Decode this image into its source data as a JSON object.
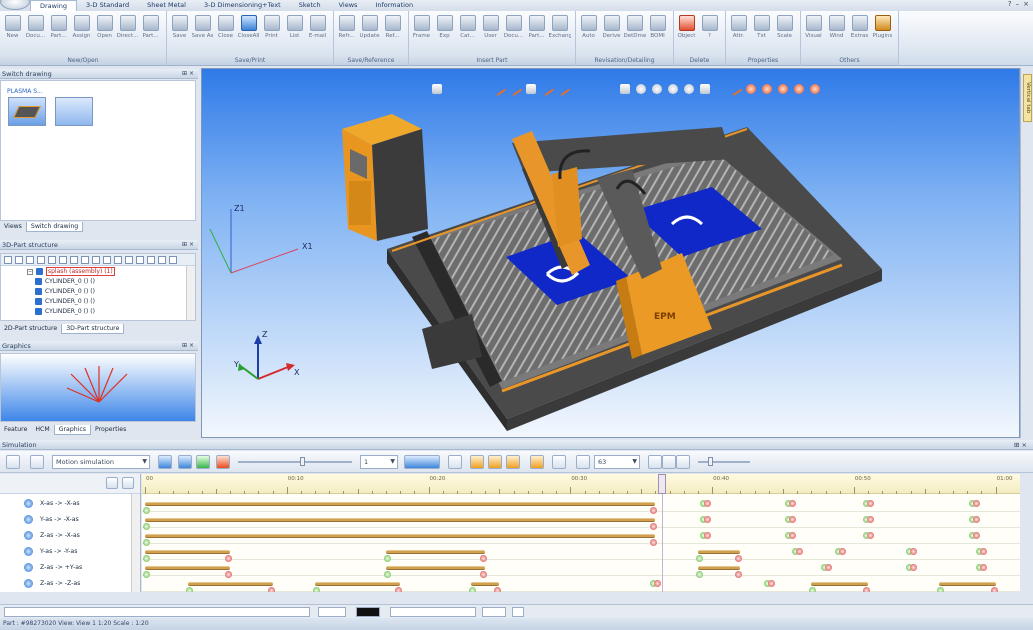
{
  "tabs": [
    "Drawing",
    "3-D Standard",
    "Sheet Metal",
    "3-D Dimensioning+Text",
    "Sketch",
    "Views",
    "Information"
  ],
  "ribbon": {
    "groups": [
      {
        "label": "New/Open",
        "buttons": [
          {
            "label": "New",
            "icon": "new-icon"
          },
          {
            "label": "Docu...",
            "icon": "document-icon"
          },
          {
            "label": "Part...",
            "icon": "part-icon"
          },
          {
            "label": "Assign",
            "icon": "assign-icon"
          },
          {
            "label": "Open",
            "icon": "open-icon"
          },
          {
            "label": "Direct...",
            "icon": "direct-icon"
          },
          {
            "label": "Part...",
            "icon": "part-icon"
          }
        ]
      },
      {
        "label": "Save/Print",
        "buttons": [
          {
            "label": "Save",
            "icon": "save-icon"
          },
          {
            "label": "Save As",
            "icon": "save-as-icon"
          },
          {
            "label": "Close",
            "icon": "close-icon"
          },
          {
            "label": "CloseAll",
            "icon": "close-all-icon"
          },
          {
            "label": "Print",
            "icon": "print-icon"
          },
          {
            "label": "List",
            "icon": "list-icon"
          },
          {
            "label": "E-mail",
            "icon": "email-icon"
          }
        ]
      },
      {
        "label": "Save/Reference",
        "buttons": [
          {
            "label": "Refr...",
            "icon": "refresh-icon"
          },
          {
            "label": "Update",
            "icon": "update-icon"
          },
          {
            "label": "Ref...",
            "icon": "reference-icon"
          }
        ]
      },
      {
        "label": "Insert Part",
        "buttons": [
          {
            "label": "Frame",
            "icon": "frame-icon"
          },
          {
            "label": "Exp",
            "icon": "export-icon"
          },
          {
            "label": "Cat...",
            "icon": "catalog-icon"
          },
          {
            "label": "User",
            "icon": "user-icon"
          },
          {
            "label": "Docu...",
            "icon": "document-icon"
          },
          {
            "label": "Part...",
            "icon": "part-icon"
          },
          {
            "label": "Exchange",
            "icon": "exchange-icon"
          }
        ]
      },
      {
        "label": "Revisation/Detailing",
        "buttons": [
          {
            "label": "Auto",
            "icon": "auto-icon"
          },
          {
            "label": "Derive",
            "icon": "derive-icon"
          },
          {
            "label": "DetDme",
            "icon": "detail-icon"
          },
          {
            "label": "BOMI",
            "icon": "bom-icon"
          }
        ]
      },
      {
        "label": "Delete",
        "buttons": [
          {
            "label": "Object",
            "icon": "delete-object-icon"
          },
          {
            "label": "?",
            "icon": "help-icon"
          }
        ]
      },
      {
        "label": "Properties",
        "buttons": [
          {
            "label": "Attr.",
            "icon": "attributes-icon"
          },
          {
            "label": "Txt",
            "icon": "text-icon"
          },
          {
            "label": "Scale",
            "icon": "scale-icon"
          }
        ]
      },
      {
        "label": "Others",
        "buttons": [
          {
            "label": "Visual",
            "icon": "visual-icon"
          },
          {
            "label": "Wind",
            "icon": "window-icon"
          },
          {
            "label": "Extras",
            "icon": "extras-icon"
          },
          {
            "label": "Plugins",
            "icon": "plugins-icon"
          }
        ]
      }
    ]
  },
  "panels": {
    "switch_drawing": {
      "title": "Switch drawing",
      "thumb_label": "PLASMA S..."
    },
    "switch_tabs": [
      "Views",
      "Switch drawing"
    ],
    "part_structure": {
      "title": "3D-Part structure",
      "items": [
        "splash (assembly) (1)",
        "CYLINDER_0 () ()",
        "CYLINDER_0 () ()",
        "CYLINDER_0 () ()",
        "CYLINDER_0 () ()"
      ]
    },
    "structure_tabs": [
      "2D-Part structure",
      "3D-Part structure"
    ],
    "graphics": {
      "title": "Graphics"
    },
    "bottom_tabs": [
      "Feature",
      "HCM",
      "Graphics",
      "Properties"
    ]
  },
  "viewport": {
    "axis_labels": {
      "z1": "Z1",
      "x1": "X1",
      "z": "Z",
      "y": "Y",
      "x": "X"
    },
    "machine_logo": "EPM",
    "side_tab": "Vertical tab"
  },
  "simulation": {
    "title": "Simulation",
    "mode": "Motion simulation",
    "speed": "1",
    "fps": "63",
    "time_labels": [
      "00",
      "00:10",
      "00:20",
      "00:30",
      "00:40",
      "00:50",
      "01:00"
    ],
    "tracks": [
      "X-as -> -X-as",
      "Y-as -> -X-as",
      "Z-as -> -X-as",
      "Y-as -> -Y-as",
      "Z-as -> +Y-as",
      "Z-as -> -Z-as"
    ],
    "timeline_bars": [
      [
        [
          0,
          36
        ],
        [
          3,
          3
        ]
      ],
      [
        [
          0,
          36
        ]
      ],
      [
        [
          0,
          36
        ]
      ],
      [
        [
          0,
          6
        ],
        [
          17,
          24
        ],
        [
          39,
          42
        ]
      ],
      [
        [
          0,
          6
        ],
        [
          17,
          24
        ],
        [
          39,
          42
        ]
      ],
      [
        [
          3,
          9
        ],
        [
          12,
          18
        ],
        [
          23,
          25
        ],
        [
          47,
          51
        ],
        [
          56,
          60
        ]
      ]
    ],
    "timeline_marks": [
      [
        39.5,
        45.5,
        51,
        58.5
      ],
      [
        39.5,
        45.5,
        51,
        58.5
      ],
      [
        39.5,
        45.5,
        51,
        58.5
      ],
      [
        46,
        49,
        54,
        59
      ],
      [
        48,
        54,
        59
      ],
      [
        36,
        44,
        66
      ]
    ],
    "cursor_time": 36.5
  },
  "status": {
    "text": "Part : #98273020  View: View 1 1:20  Scale : 1:20"
  }
}
